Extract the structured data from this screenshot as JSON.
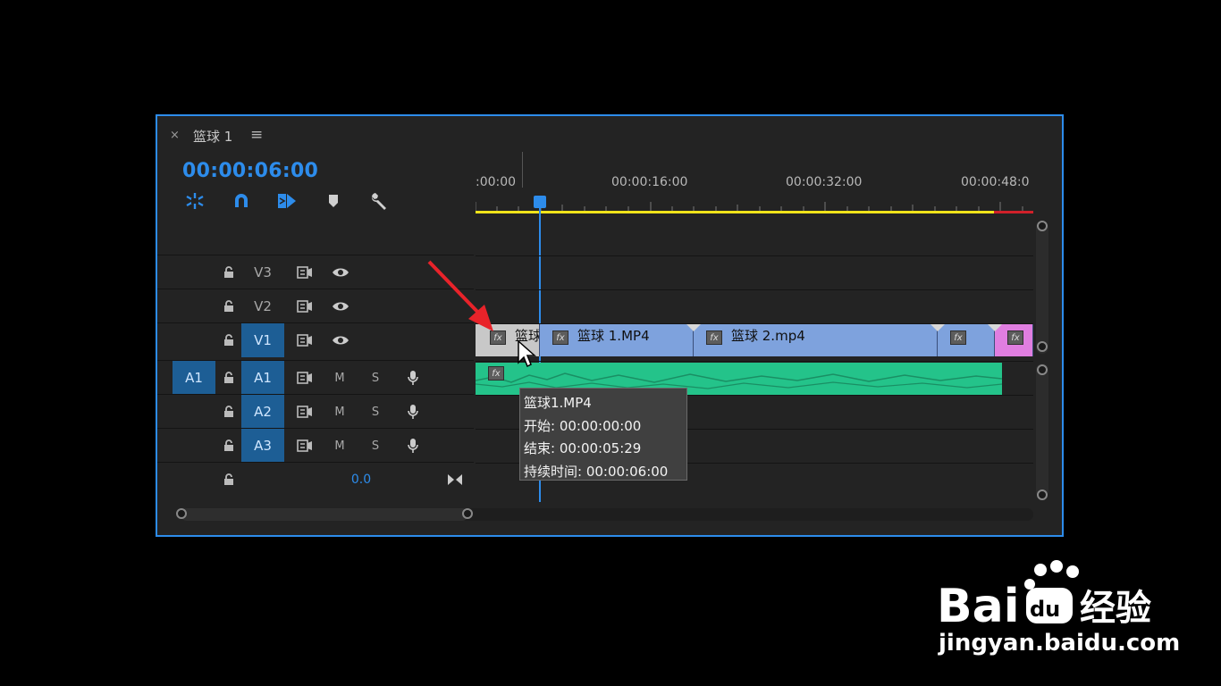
{
  "sequence_tab": {
    "close": "×",
    "title": "篮球 1",
    "menu": "≡"
  },
  "timecode": "00:00:06:00",
  "tools": [
    {
      "name": "snap-in-timeline-icon"
    },
    {
      "name": "magnet-icon"
    },
    {
      "name": "linked-selection-icon"
    },
    {
      "name": "add-marker-icon"
    },
    {
      "name": "wrench-icon"
    }
  ],
  "ruler": {
    "labels": [
      ":00:00",
      "00:00:16:00",
      "00:00:32:00",
      "00:00:48:0"
    ],
    "playhead_time": "00:00:06:00"
  },
  "tracks": {
    "video": [
      {
        "name": "V3",
        "active": false
      },
      {
        "name": "V2",
        "active": false
      },
      {
        "name": "V1",
        "active": true
      }
    ],
    "audio": [
      {
        "source": "A1",
        "name": "A1",
        "mute": "M",
        "solo": "S"
      },
      {
        "name": "A2",
        "mute": "M",
        "solo": "S"
      },
      {
        "name": "A3",
        "mute": "M",
        "solo": "S"
      }
    ],
    "master_value": "0.0"
  },
  "clips": {
    "v1": [
      {
        "label": "篮球",
        "color": "#c8c8c8",
        "fx": "fx"
      },
      {
        "label": "篮球 1.MP4",
        "color": "#7ea2dd",
        "fx": "fx"
      },
      {
        "label": "篮球 2.mp4",
        "color": "#7ea2dd",
        "fx": "fx"
      },
      {
        "label": "",
        "color": "#7ea2dd",
        "fx": "fx"
      },
      {
        "label": "",
        "color": "#e07ee0",
        "fx": "fx"
      }
    ],
    "a1": {
      "fx": "fx",
      "color": "#24c38a"
    }
  },
  "tooltip": {
    "name": "篮球1.MP4",
    "start": "开始: 00:00:00:00",
    "end": "结束: 00:00:05:29",
    "duration": "持续时间: 00:00:06:00"
  },
  "colors": {
    "accent": "#2d8ceb",
    "work_area": "#f0e31a",
    "work_area_unrendered": "#d0202a",
    "audio_wave": "#24c38a",
    "arrow": "#e8232a"
  },
  "watermark": {
    "logo_text": "Bai du 经验",
    "url": "jingyan.baidu.com"
  }
}
